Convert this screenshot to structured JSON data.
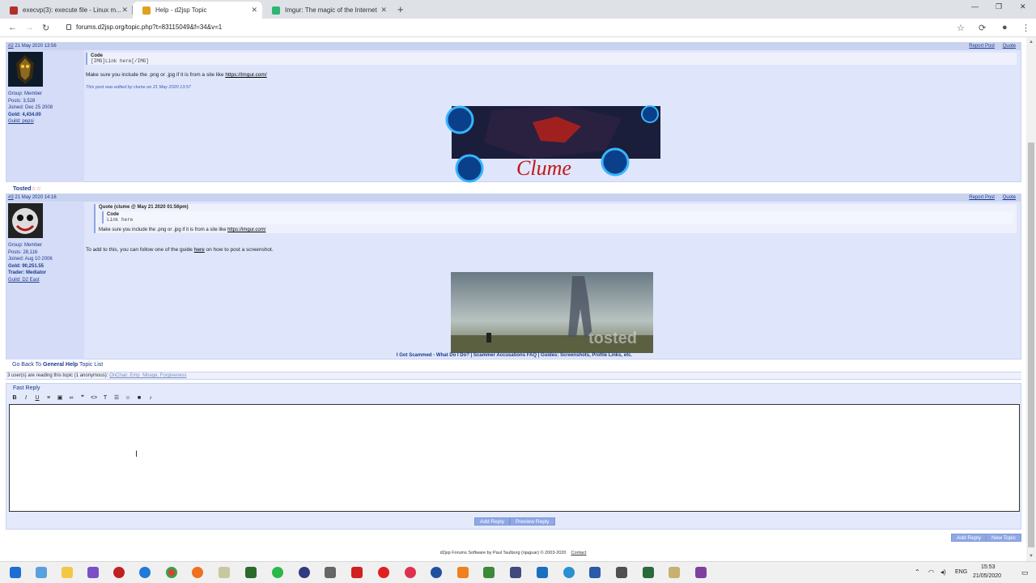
{
  "browser": {
    "tabs": [
      {
        "label": "execvp(3): execute file - Linux m...",
        "close": "✕"
      },
      {
        "label": "Help - d2jsp Topic",
        "close": "✕"
      },
      {
        "label": "Imgur: The magic of the Internet",
        "close": "✕"
      }
    ],
    "new_tab": "+",
    "url": "forums.d2jsp.org/topic.php?t=83115049&f=34&v=1"
  },
  "post2": {
    "header": "#2 21 May 2020 13:56",
    "num_link": "2",
    "date": "21 May 2020 13:56",
    "report": "Report Post",
    "quote": "Quote",
    "sidebar": {
      "group": "Group: Member",
      "posts": "Posts: 3,528",
      "joined": "Joined: Dec 25 2008",
      "gold": "Gold: 4,434.00",
      "guild": "Guild: pepsi"
    },
    "code_title": "Code",
    "code_text": "[IMG]Link here[/IMG]",
    "text": "Make sure you include the .png or .jpg if it is from a site like ",
    "link": "https://imgur.com/",
    "edited": "This post was edited by clume on 21 May 2020 13:57",
    "sig_text": "Clume"
  },
  "post3": {
    "username": "Tosted",
    "header_num": "#3",
    "date": "21 May 2020 14:16",
    "report": "Report Post",
    "quote": "Quote",
    "sidebar": {
      "group": "Group: Member",
      "posts": "Posts: 28,116",
      "joined": "Joined: Aug 10 2006",
      "gold": "Gold: 90,251.55",
      "trader": "Trader: Mediator",
      "guild": "Guild: D2 East"
    },
    "quote_title": "Quote (clume @ May 21 2020 01:56pm)",
    "inner_code_title": "Code",
    "inner_code_text": "Link here",
    "quote_text": "Make sure you include the .png or .jpg if it is from a site like ",
    "quote_link": "https://imgur.com/",
    "text_before": "To add to this, you can follow one of the guide ",
    "text_link": "here",
    "text_after": " on how to post a screenshot.",
    "sig_watermark": "tosted",
    "sig_links": "I Got Scammed - What Do I Do? | Scammer Accusations FAQ | Guides: Screenshots, Profile Links, etc."
  },
  "go_back": {
    "prefix": "Go Back To ",
    "forum": "General Help",
    "suffix": " Topic List"
  },
  "readers": {
    "text": "3 user(s) are reading this topic (1 anonymous): ",
    "users": "OnChair, Emp_Mirage, Forgiveness"
  },
  "fast_reply": {
    "title": "Fast Reply",
    "toolbar": [
      "B",
      "I",
      "U",
      "≡",
      "▣",
      "∞",
      "❞",
      "<>",
      "T",
      "☰",
      "☺",
      "■",
      "♪"
    ],
    "add_reply": "Add Reply",
    "preview_reply": "Preview Reply"
  },
  "bottom_buttons": {
    "add_reply": "Add Reply",
    "new_topic": "New Topic"
  },
  "footer": {
    "text": "d2jsp Forums Software by Paul Taulborg (njaguar) © 2003-2020",
    "contact": "Contact"
  },
  "taskbar": {
    "lang": "ENG",
    "time": "15:53",
    "date": "21/05/2020"
  },
  "colors": {
    "accent": "#1b3a8c",
    "post_bg": "#dfe6fb",
    "sidebar_bg": "#d4dcf7"
  }
}
